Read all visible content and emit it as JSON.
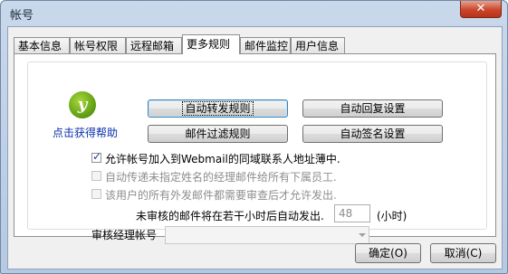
{
  "window": {
    "title": "帐号",
    "close_glyph": "✕"
  },
  "tabs": [
    {
      "label": "基本信息"
    },
    {
      "label": "帐号权限"
    },
    {
      "label": "远程邮箱"
    },
    {
      "label": "更多规则",
      "active": true
    },
    {
      "label": "邮件监控"
    },
    {
      "label": "用户信息"
    }
  ],
  "help": {
    "icon": "help-logo-icon",
    "icon_glyph": "y",
    "label": "点击获得帮助"
  },
  "buttons": {
    "auto_forward": "自动转发规则",
    "auto_reply": "自动回复设置",
    "mail_filter": "邮件过滤规则",
    "auto_signature": "自动签名设置"
  },
  "options": [
    {
      "label": "允许帐号加入到Webmail的同域联系人地址薄中.",
      "checked": true,
      "enabled": true
    },
    {
      "label": "自动传递未指定姓名的经理邮件给所有下属员工.",
      "checked": false,
      "enabled": false
    },
    {
      "label": "该用户的所有外发邮件都需要审查后才允许发出.",
      "checked": false,
      "enabled": false
    }
  ],
  "review": {
    "delay_label": "未审核的邮件将在若干小时后自动发出.",
    "delay_value": "48",
    "unit": "(小时)",
    "manager_label": "审核经理帐号",
    "manager_value": ""
  },
  "footer": {
    "ok": "确定(O)",
    "cancel": "取消(C)"
  }
}
